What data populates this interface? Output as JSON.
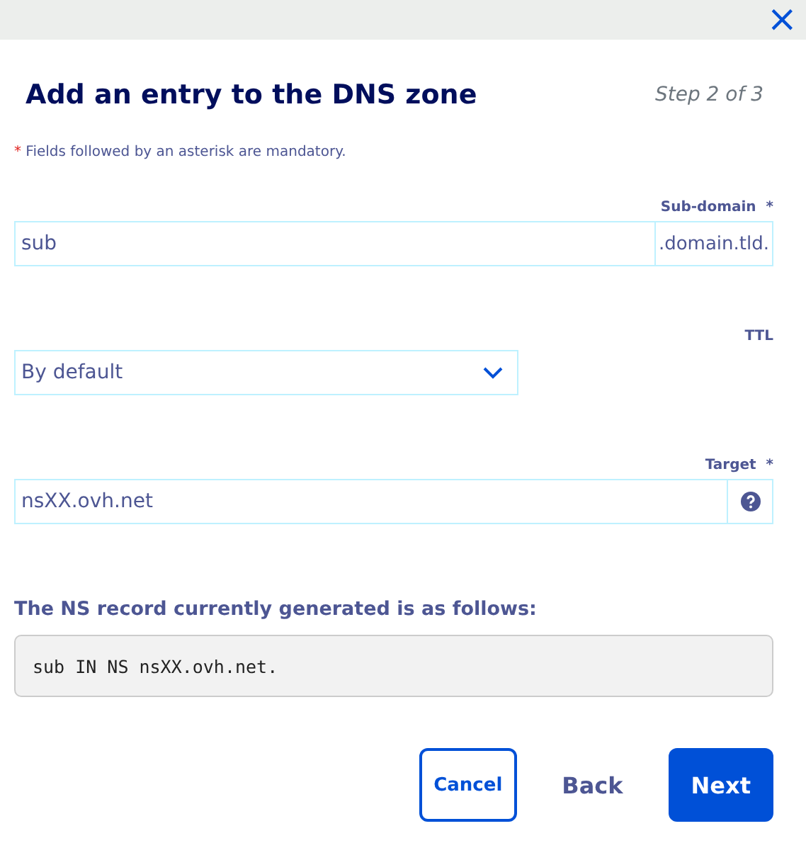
{
  "close_label": "×",
  "title": "Add an entry to the DNS zone",
  "step": "Step 2 of 3",
  "note": {
    "mark": "*",
    "text": "Fields followed by an asterisk are mandatory."
  },
  "subdomain": {
    "label": "Sub-domain",
    "mark": "*",
    "value": "sub",
    "suffix": ".domain.tld."
  },
  "ttl": {
    "label": "TTL",
    "value": "By default"
  },
  "target": {
    "label": "Target",
    "mark": "*",
    "value": "nsXX.ovh.net"
  },
  "record": {
    "heading": "The NS record currently generated is as follows:",
    "code": "sub IN NS nsXX.ovh.net."
  },
  "buttons": [
    {
      "label": "Cancel",
      "kind": "outline"
    },
    {
      "label": "Back",
      "kind": "text"
    },
    {
      "label": "Next",
      "kind": "primary"
    }
  ]
}
